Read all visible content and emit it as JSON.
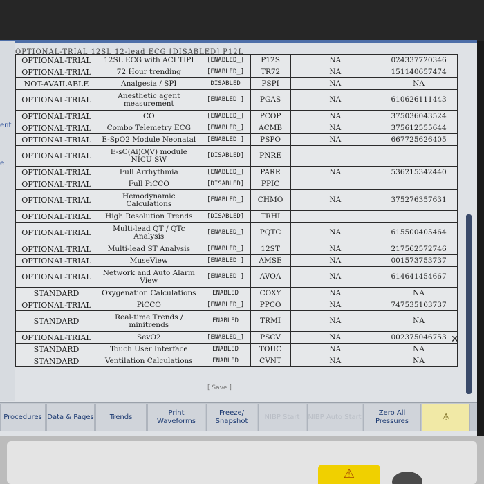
{
  "left_fragments": [
    "ent",
    "e"
  ],
  "table_header_partial": "OPTIONAL-TRIAL   12SL 12-lead ECG   [DISABLED]   P12L",
  "rows": [
    {
      "status": "OPTIONAL-TRIAL",
      "name": "12SL ECG with ACI TIPI",
      "config": "[ENABLED_]",
      "code": "P12S",
      "na": "NA",
      "key": "024337720346",
      "tall": false
    },
    {
      "status": "OPTIONAL-TRIAL",
      "name": "72 Hour trending",
      "config": "[ENABLED_]",
      "code": "TR72",
      "na": "NA",
      "key": "151140657474",
      "tall": false
    },
    {
      "status": "NOT-AVAILABLE",
      "name": "Analgesia / SPI",
      "config": "DISABLED",
      "code": "PSPI",
      "na": "NA",
      "key": "NA",
      "tall": false
    },
    {
      "status": "OPTIONAL-TRIAL",
      "name": "Anesthetic agent measurement",
      "config": "[ENABLED_]",
      "code": "PGAS",
      "na": "NA",
      "key": "610626111443",
      "tall": true
    },
    {
      "status": "OPTIONAL-TRIAL",
      "name": "CO",
      "config": "[ENABLED_]",
      "code": "PCOP",
      "na": "NA",
      "key": "375036043524",
      "tall": false
    },
    {
      "status": "OPTIONAL-TRIAL",
      "name": "Combo Telemetry ECG",
      "config": "[ENABLED_]",
      "code": "ACMB",
      "na": "NA",
      "key": "375612555644",
      "tall": false
    },
    {
      "status": "OPTIONAL-TRIAL",
      "name": "E-SpO2 Module Neonatal",
      "config": "[ENABLED_]",
      "code": "PSPO",
      "na": "NA",
      "key": "667725626405",
      "tall": false
    },
    {
      "status": "OPTIONAL-TRIAL",
      "name": "E-sC(Ai)O(V) module NICU SW",
      "config": "[DISABLED]",
      "code": "PNRE",
      "na": "",
      "key": "",
      "tall": true
    },
    {
      "status": "OPTIONAL-TRIAL",
      "name": "Full Arrhythmia",
      "config": "[ENABLED_]",
      "code": "PARR",
      "na": "NA",
      "key": "536215342440",
      "tall": false
    },
    {
      "status": "OPTIONAL-TRIAL",
      "name": "Full PiCCO",
      "config": "[DISABLED]",
      "code": "PPIC",
      "na": "",
      "key": "",
      "tall": false
    },
    {
      "status": "OPTIONAL-TRIAL",
      "name": "Hemodynamic Calculations",
      "config": "[ENABLED_]",
      "code": "CHMO",
      "na": "NA",
      "key": "375276357631",
      "tall": true
    },
    {
      "status": "OPTIONAL-TRIAL",
      "name": "High Resolution Trends",
      "config": "[DISABLED]",
      "code": "TRHI",
      "na": "",
      "key": "",
      "tall": false
    },
    {
      "status": "OPTIONAL-TRIAL",
      "name": "Multi-lead QT / QTc Analysis",
      "config": "[ENABLED_]",
      "code": "PQTC",
      "na": "NA",
      "key": "615500405464",
      "tall": true
    },
    {
      "status": "OPTIONAL-TRIAL",
      "name": "Multi-lead ST Analysis",
      "config": "[ENABLED_]",
      "code": "12ST",
      "na": "NA",
      "key": "217562572746",
      "tall": false
    },
    {
      "status": "OPTIONAL-TRIAL",
      "name": "MuseView",
      "config": "[ENABLED_]",
      "code": "AMSE",
      "na": "NA",
      "key": "001573753737",
      "tall": false
    },
    {
      "status": "OPTIONAL-TRIAL",
      "name": "Network and Auto Alarm View",
      "config": "[ENABLED_]",
      "code": "AVOA",
      "na": "NA",
      "key": "614641454667",
      "tall": true
    },
    {
      "status": "STANDARD",
      "name": "Oxygenation Calculations",
      "config": "ENABLED",
      "code": "COXY",
      "na": "NA",
      "key": "NA",
      "tall": false
    },
    {
      "status": "OPTIONAL-TRIAL",
      "name": "PiCCO",
      "config": "[ENABLED_]",
      "code": "PPCO",
      "na": "NA",
      "key": "747535103737",
      "tall": false
    },
    {
      "status": "STANDARD",
      "name": "Real-time Trends / minitrends",
      "config": "ENABLED",
      "code": "TRMI",
      "na": "NA",
      "key": "NA",
      "tall": true
    },
    {
      "status": "OPTIONAL-TRIAL",
      "name": "SevO2",
      "config": "[ENABLED_]",
      "code": "PSCV",
      "na": "NA",
      "key": "002375046753",
      "tall": false
    },
    {
      "status": "STANDARD",
      "name": "Touch User Interface",
      "config": "ENABLED",
      "code": "TOUC",
      "na": "NA",
      "key": "NA",
      "tall": false
    },
    {
      "status": "STANDARD",
      "name": "Ventilation Calculations",
      "config": "ENABLED",
      "code": "CVNT",
      "na": "NA",
      "key": "NA",
      "tall": false
    }
  ],
  "save_label": "[ Save ]",
  "close_glyph": "✕",
  "softkeys": [
    {
      "label": "Procedures",
      "dim": false
    },
    {
      "label": "Data & Pages",
      "dim": false
    },
    {
      "label": "Trends",
      "dim": false
    },
    {
      "label": "Print Waveforms",
      "dim": false
    },
    {
      "label": "Freeze/ Snapshot",
      "dim": false
    },
    {
      "label": "NIBP Start",
      "dim": true
    },
    {
      "label": "NIBP Auto Start",
      "dim": true
    },
    {
      "label": "Zero All Pressures",
      "dim": false
    },
    {
      "label": "",
      "dim": false,
      "alarm": true
    }
  ],
  "icons": {
    "alarm_silence": "alarm-bell-icon",
    "close": "close-icon"
  }
}
